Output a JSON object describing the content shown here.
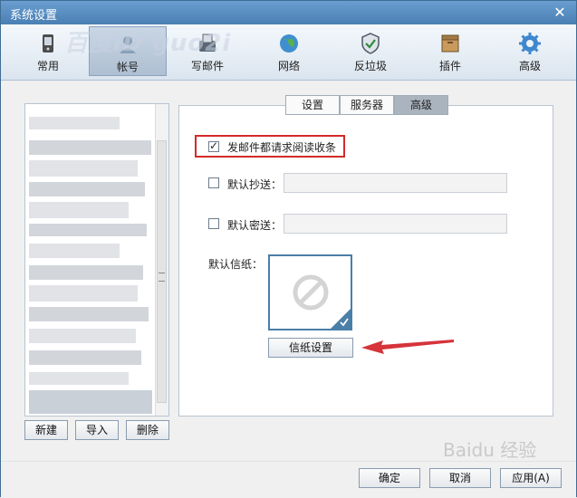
{
  "window": {
    "title": "系统设置",
    "watermark": "百度ID guo2i"
  },
  "toolbar": {
    "items": [
      {
        "label": "常用",
        "icon": "phone-icon"
      },
      {
        "label": "帐号",
        "icon": "account-icon"
      },
      {
        "label": "写邮件",
        "icon": "compose-icon"
      },
      {
        "label": "网络",
        "icon": "globe-icon"
      },
      {
        "label": "反垃圾",
        "icon": "shield-icon"
      },
      {
        "label": "插件",
        "icon": "plugin-icon"
      },
      {
        "label": "高级",
        "icon": "gear-icon"
      }
    ],
    "active": "帐号"
  },
  "account_buttons": {
    "new": "新建",
    "import": "导入",
    "delete": "删除"
  },
  "tabs": {
    "settings": "设置",
    "server": "服务器",
    "advanced": "高级",
    "active": "高级"
  },
  "advanced": {
    "read_receipt": {
      "label": "发邮件都请求阅读收条",
      "checked": true
    },
    "default_cc": {
      "label": "默认抄送：",
      "checked": false,
      "value": ""
    },
    "default_bcc": {
      "label": "默认密送：",
      "checked": false,
      "value": ""
    },
    "stationery_label": "默认信纸：",
    "stationery_button": "信纸设置"
  },
  "footer": {
    "ok": "确定",
    "cancel": "取消",
    "apply": "应用(A)"
  },
  "colors": {
    "title_bar": "#4a7fb4",
    "highlight": "#d32a2a",
    "stationery_border": "#4a7fa8"
  }
}
